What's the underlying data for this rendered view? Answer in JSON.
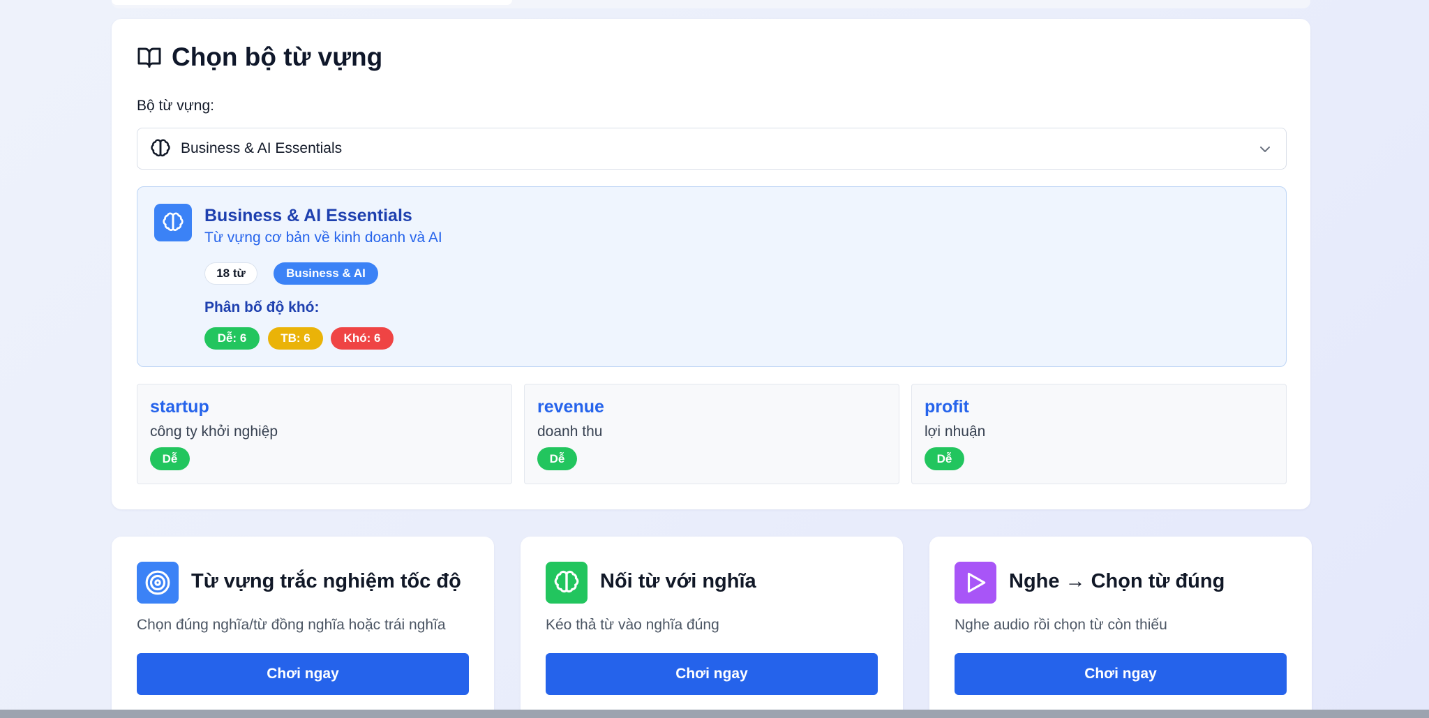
{
  "colors": {
    "primary": "#2563eb",
    "easy": "#22c55e",
    "medium": "#eab308",
    "hard": "#ef4444",
    "game1": "#3b82f6",
    "game2": "#22c55e",
    "game3": "#a855f7"
  },
  "section": {
    "title": "Chọn bộ từ vựng",
    "icon": "book-open-icon"
  },
  "selector": {
    "label": "Bộ từ vựng:",
    "value": "Business & AI Essentials",
    "icon": "brain-icon"
  },
  "set_info": {
    "title": "Business & AI Essentials",
    "description": "Từ vựng cơ bản về kinh doanh và AI",
    "word_count": "18 từ",
    "category": "Business & AI",
    "distribution_label": "Phân bố độ khó:",
    "easy": "Dễ: 6",
    "medium": "TB: 6",
    "hard": "Khó: 6"
  },
  "words": [
    {
      "word": "startup",
      "meaning": "công ty khởi nghiệp",
      "level": "Dễ"
    },
    {
      "word": "revenue",
      "meaning": "doanh thu",
      "level": "Dễ"
    },
    {
      "word": "profit",
      "meaning": "lợi nhuận",
      "level": "Dễ"
    }
  ],
  "games": [
    {
      "title": "Từ vựng trắc nghiệm tốc độ",
      "description": "Chọn đúng nghĩa/từ đồng nghĩa hoặc trái nghĩa",
      "button": "Chơi ngay",
      "icon": "target-icon"
    },
    {
      "title": "Nối từ với nghĩa",
      "description": "Kéo thả từ vào nghĩa đúng",
      "button": "Chơi ngay",
      "icon": "brain-icon"
    },
    {
      "title": "Nghe → Chọn từ đúng",
      "description": "Nghe audio rồi chọn từ còn thiếu",
      "button": "Chơi ngay",
      "icon": "play-icon"
    }
  ]
}
